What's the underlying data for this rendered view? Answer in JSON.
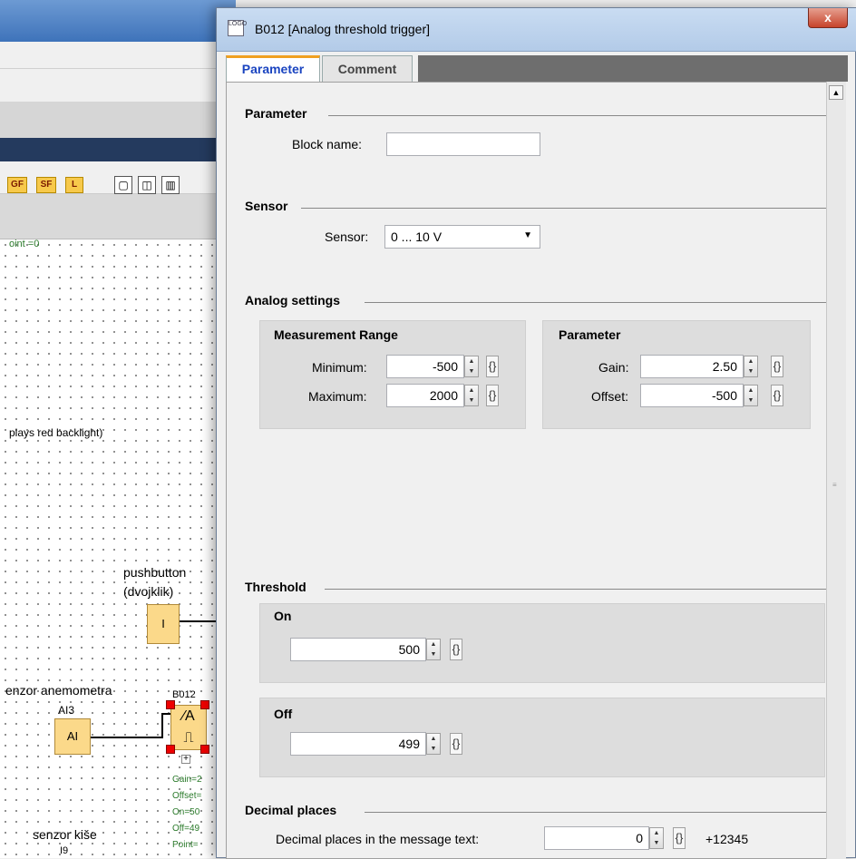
{
  "canvas": {
    "text_point": "oint =0",
    "text_backlight": "plays red backlight)",
    "pushbutton_label_1": "pushbutton",
    "pushbutton_label_2": "(dvojklik)",
    "pushbutton_block": "I",
    "anemometer_label": "enzor anemometra",
    "ai_name": "AI3",
    "ai_block": "AI",
    "block_name": "B012",
    "green_params": [
      "Gain=2",
      "Offset=",
      "On=50",
      "Off=49",
      "Point="
    ],
    "rain_label": "senzor kiše",
    "rain_sub": "I9",
    "toolbar_buttons": [
      "GF",
      "SF",
      "L"
    ]
  },
  "dialog": {
    "title": "B012 [Analog threshold trigger]",
    "icon_text": "LOGO",
    "close": "x",
    "tabs": [
      "Parameter",
      "Comment"
    ],
    "sections": {
      "parameter": "Parameter",
      "sensor": "Sensor",
      "analog": "Analog settings",
      "threshold": "Threshold",
      "decimal": "Decimal places"
    },
    "block_name_label": "Block name:",
    "block_name_value": "",
    "sensor_label": "Sensor:",
    "sensor_value": "0 ... 10 V",
    "measurement": {
      "title": "Measurement Range",
      "min_label": "Minimum:",
      "min_value": "-500",
      "max_label": "Maximum:",
      "max_value": "2000"
    },
    "param": {
      "title": "Parameter",
      "gain_label": "Gain:",
      "gain_value": "2.50",
      "offset_label": "Offset:",
      "offset_value": "-500"
    },
    "on": {
      "title": "On",
      "value": "500"
    },
    "off": {
      "title": "Off",
      "value": "499"
    },
    "decimal_label": "Decimal places in the message text:",
    "decimal_value": "0",
    "decimal_preview": "+12345"
  }
}
